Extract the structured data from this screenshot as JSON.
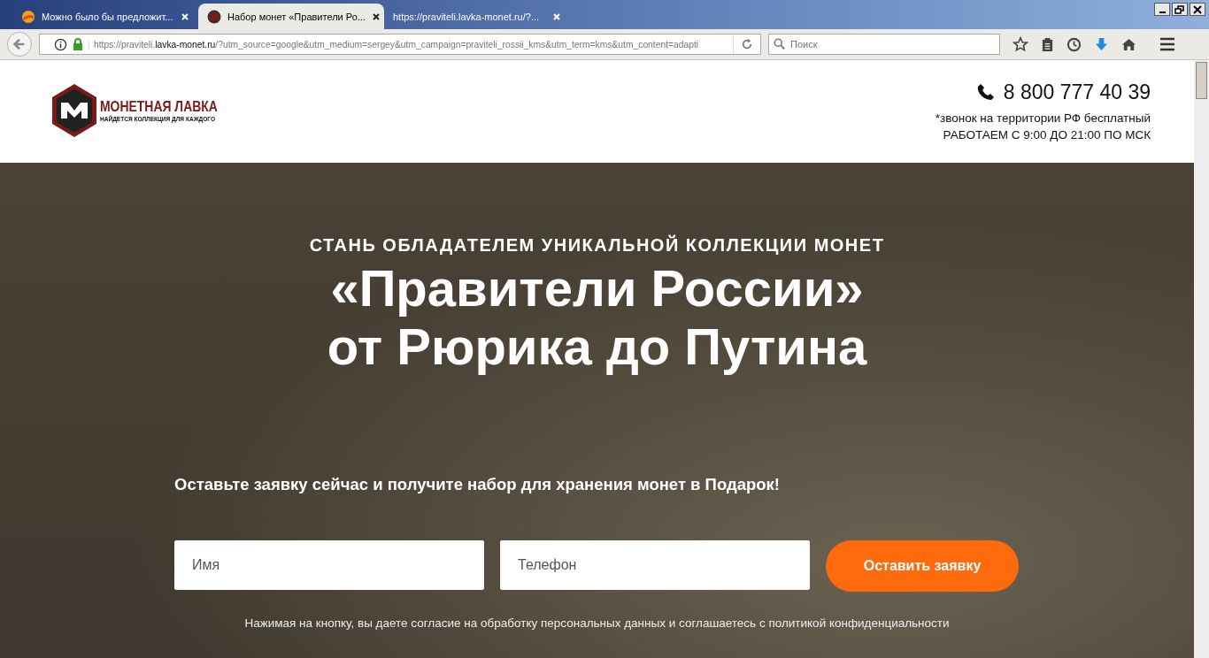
{
  "browser": {
    "tabs": [
      {
        "title": "Можно было бы предложит...",
        "selected": false
      },
      {
        "title": "Набор монет «Правители Ро...",
        "selected": true
      },
      {
        "title": "https://praviteli.lavka-monet.ru/?...",
        "selected": false
      }
    ],
    "address_bar": {
      "url_prefix": "https://praviteli.",
      "url_domain": "lavka-monet.ru",
      "url_rest": "/?utm_source=google&utm_medium=sergey&utm_campaign=praviteli_rossii_kms&utm_term=kms&utm_content=adapti"
    },
    "search": {
      "placeholder": "Поиск"
    }
  },
  "header": {
    "logo": {
      "title": "МОНЕТНАЯ ЛАВКА",
      "tagline": "НАЙДЕТСЯ КОЛЛЕКЦИЯ ДЛЯ КАЖДОГО"
    },
    "phone": "8 800 777 40 39",
    "note": "*звонок на территории РФ бесплатный",
    "hours": "РАБОТАЕМ С 9:00 ДО 21:00 ПО МСК"
  },
  "hero": {
    "kicker": "СТАНЬ ОБЛАДАТЕЛЕМ УНИКАЛЬНОЙ КОЛЛЕКЦИИ МОНЕТ",
    "title_lines": [
      "«Правители России»",
      "от Рюрика до Путина"
    ],
    "offer": "Оставьте заявку сейчас и получите набор для хранения монет в Подарок!",
    "fields": [
      {
        "placeholder": "Имя"
      },
      {
        "placeholder": "Телефон"
      }
    ],
    "submit": "Оставить заявку",
    "consent": "Нажимая на кнопку, вы даете согласие на обработку персональных данных и соглашаетесь с политикой конфиденциальности"
  }
}
